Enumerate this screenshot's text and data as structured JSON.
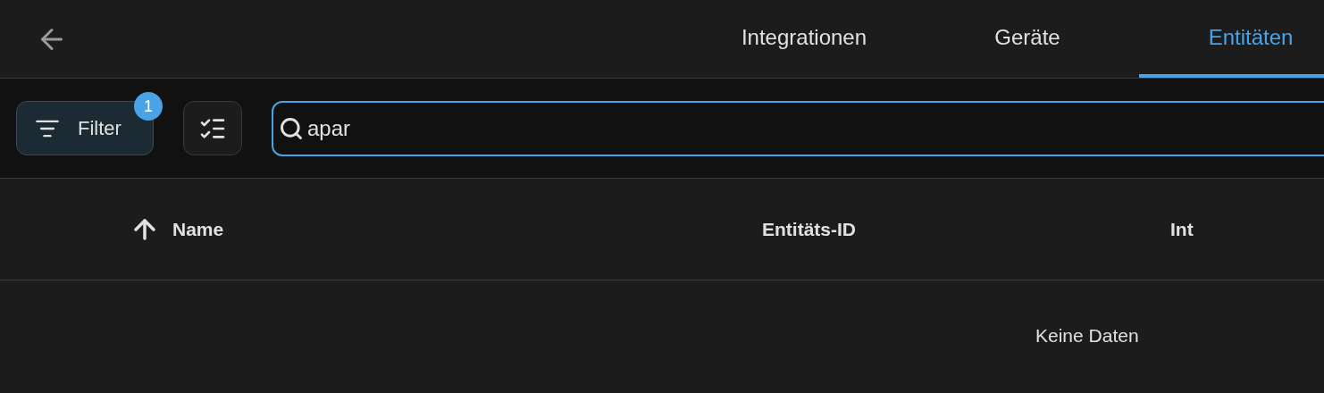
{
  "tabs": [
    {
      "label": "Integrationen",
      "selected": false
    },
    {
      "label": "Geräte",
      "selected": false
    },
    {
      "label": "Entitäten",
      "selected": true
    }
  ],
  "toolbar": {
    "filter": {
      "label": "Filter",
      "badge": "1"
    },
    "search": {
      "value": "apar"
    }
  },
  "table": {
    "columns": [
      {
        "label": "Name",
        "sorted": true
      },
      {
        "label": "Entitäts-ID",
        "sorted": false
      },
      {
        "label": "Int",
        "sorted": false
      }
    ],
    "empty_text": "Keine Daten"
  }
}
